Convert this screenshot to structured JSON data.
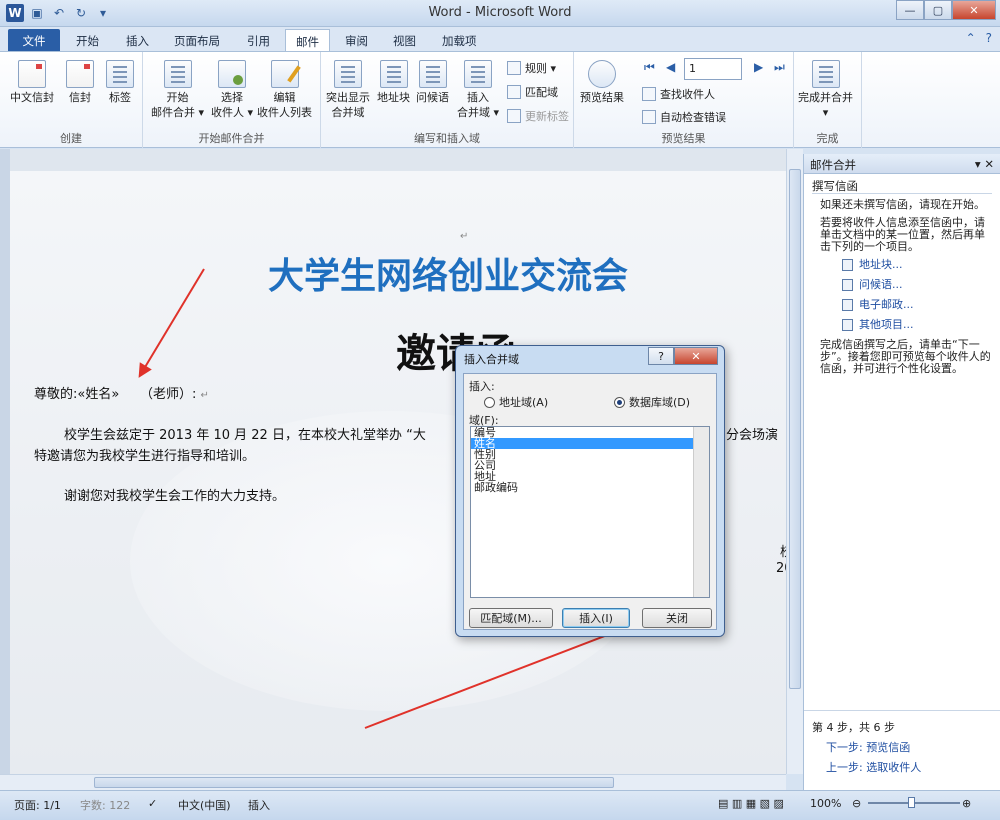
{
  "titlebar": {
    "title": "Word - Microsoft Word"
  },
  "tabs": [
    "文件",
    "开始",
    "插入",
    "页面布局",
    "引用",
    "邮件",
    "审阅",
    "视图",
    "加载项"
  ],
  "active_tab": "邮件",
  "ribbon": {
    "groups": {
      "create": {
        "label": "创建",
        "buttons": [
          "中文信封",
          "信封",
          "标签"
        ]
      },
      "start": {
        "label": "开始邮件合并",
        "b1": "开始",
        "b1b": "邮件合并 ▾",
        "b2": "选择",
        "b2b": "收件人 ▾",
        "b3": "编辑",
        "b3b": "收件人列表"
      },
      "write": {
        "label": "编写和插入域",
        "b1": "突出显示",
        "b1b": "合并域",
        "b2": "地址块",
        "b3": "问候语",
        "b4": "插入",
        "b4b": "合并域 ▾",
        "s1": "规则 ▾",
        "s2": "匹配域",
        "s3": "更新标签"
      },
      "preview": {
        "label": "预览结果",
        "b1": "预览结果",
        "record": "1",
        "s1": "查找收件人",
        "s2": "自动检查错误"
      },
      "finish": {
        "label": "完成",
        "b1": "完成并合并",
        "b1b": "▾"
      }
    }
  },
  "document": {
    "heading": "大学生网络创业交流会",
    "subheading": "邀请函",
    "line1_prefix": "尊敬的:",
    "line1_field": "«姓名»",
    "line1_suffix": "（老师）:",
    "line2": "校学生会兹定于 2013 年 10 月 22 日，在本校大礼堂举办 “大",
    "line2_right": "分会场演",
    "line3": "特邀请您为我校学生进行指导和培训。",
    "line4": "谢谢您对我校学生会工作的大力支持。",
    "sign1": "校",
    "sign2": "20"
  },
  "pane": {
    "title": "邮件合并",
    "section": "撰写信函",
    "p1": "如果还未撰写信函，请现在开始。",
    "p2": "若要将收件人信息添至信函中，请单击文档中的某一位置，然后再单击下列的一个项目。",
    "links": [
      "地址块...",
      "问候语...",
      "电子邮政...",
      "其他项目..."
    ],
    "p3": "完成信函撰写之后，请单击“下一步”。接着您即可预览每个收件人的信函，并可进行个性化设置。",
    "step": "第 4 步，共 6 步",
    "next": "下一步: 预览信函",
    "prev": "上一步: 选取收件人"
  },
  "dialog": {
    "title": "插入合并域",
    "insert_label": "插入:",
    "radio_address": "地址域(A)",
    "radio_db": "数据库域(D)",
    "selected_radio": "数据库域(D)",
    "fields_label": "域(F):",
    "fields": [
      "编号",
      "姓名",
      "性别",
      "公司",
      "地址",
      "邮政编码"
    ],
    "selected_field": "姓名",
    "btn_match": "匹配域(M)...",
    "btn_insert": "插入(I)",
    "btn_close": "关闭"
  },
  "status": {
    "page": "页面: 1/1",
    "words": "字数: 122",
    "lang": "中文(中国)",
    "mode": "插入",
    "zoom": "100%"
  },
  "colors": {
    "accent": "#2a5ea6",
    "heading": "#1f6fbf",
    "arrow": "#e0322a"
  }
}
